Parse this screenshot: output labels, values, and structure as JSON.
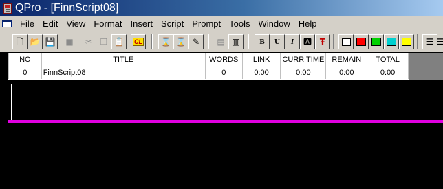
{
  "window": {
    "title": "QPro - [FinnScript08]"
  },
  "menu": [
    "File",
    "Edit",
    "View",
    "Format",
    "Insert",
    "Script",
    "Prompt",
    "Tools",
    "Window",
    "Help"
  ],
  "toolbar": {
    "cl_label": "CL",
    "bold": "B",
    "underline": "U",
    "italic": "I",
    "colors": [
      "#ff0000",
      "#00d000",
      "#00d0d0",
      "#ffff00"
    ],
    "icons": [
      "new-document-icon",
      "open-folder-icon",
      "save-icon",
      "save-disabled-icon",
      "cut-icon",
      "copy-icon",
      "paste-icon",
      "cl-icon",
      "prompt-icon",
      "prompt2-icon",
      "pen-icon",
      "layout-icon",
      "layout2-icon",
      "bold-icon",
      "underline-icon",
      "italic-icon",
      "font-icon",
      "text-color-icon",
      "box-outline-icon",
      "red-swatch",
      "green-swatch",
      "cyan-swatch",
      "yellow-swatch",
      "align-left-icon",
      "align-center-icon"
    ]
  },
  "grid": {
    "headers": [
      "NO",
      "TITLE",
      "WORDS",
      "LINK",
      "CURR TIME",
      "REMAIN",
      "TOTAL"
    ],
    "rows": [
      {
        "no": "0",
        "title": "FinnScript08",
        "words": "0",
        "link": "0:00",
        "curr_time": "0:00",
        "remain": "0:00",
        "total": "0:00"
      }
    ]
  }
}
